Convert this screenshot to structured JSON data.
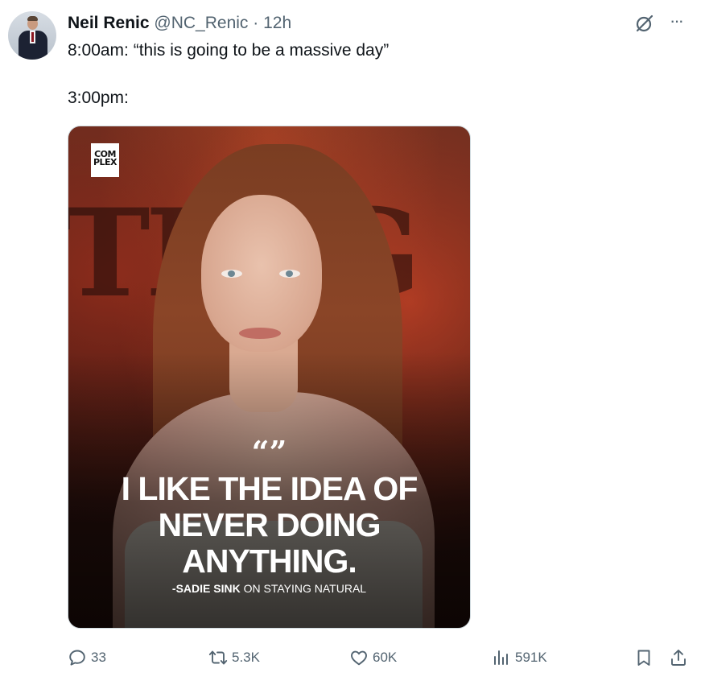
{
  "author": {
    "name": "Neil Renic",
    "handle": "@NC_Renic",
    "separator": "·",
    "time": "12h"
  },
  "tweet": {
    "line1": "8:00am: “this is going to be a massive day”",
    "line2": "3:00pm:"
  },
  "media": {
    "logo_line1": "COM",
    "logo_line2": "PLEX",
    "quote_mark": "“”",
    "quote_lines": [
      "I LIKE THE IDEA OF",
      "NEVER DOING",
      "ANYTHING."
    ],
    "credit_name": "-SADIE SINK",
    "credit_rest": " ON STAYING NATURAL"
  },
  "actions": {
    "replies": "33",
    "reposts": "5.3K",
    "likes": "60K",
    "views": "591K"
  },
  "icons": {
    "reply": "reply-icon",
    "repost": "repost-icon",
    "like": "heart-icon",
    "views": "views-icon",
    "bookmark": "bookmark-icon",
    "share": "share-icon",
    "grok": "grok-icon",
    "more": "more-icon"
  },
  "colors": {
    "text": "#0f1419",
    "secondary": "#536471",
    "border": "#cfd9de"
  }
}
